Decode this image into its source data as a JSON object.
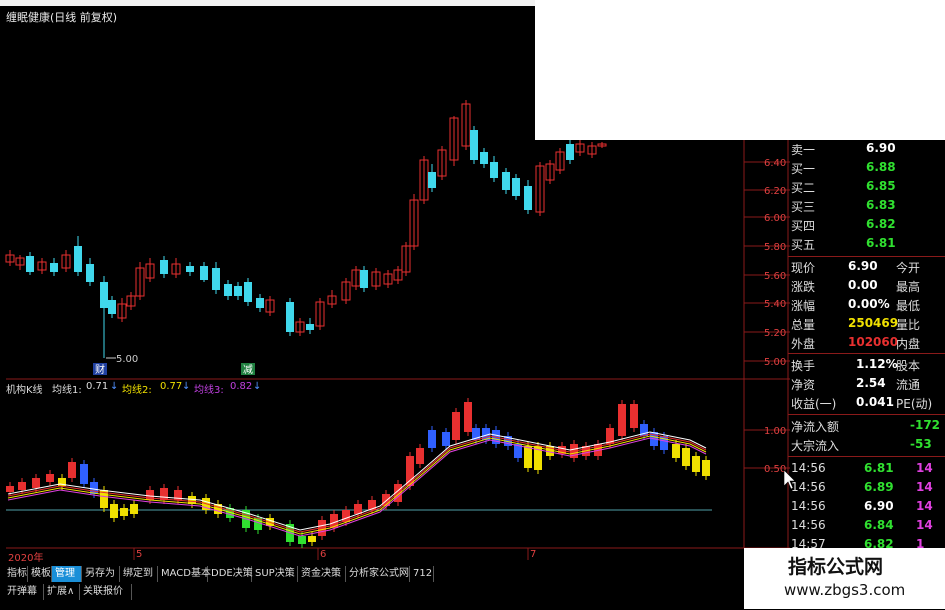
{
  "window": {
    "title": "缠眠健康(日线 前复权)"
  },
  "price_axis": [
    "6.40",
    "6.20",
    "6.00",
    "5.80",
    "5.60",
    "5.40",
    "5.20",
    "5.00"
  ],
  "low_marker": "5.00",
  "candle_labels": {
    "cai": "财",
    "jian": "减"
  },
  "indicator": {
    "name": "机构K线",
    "ma1_label": "均线1:",
    "ma1_value": "0.71",
    "ma2_label": "均线2:",
    "ma2_value": "0.77",
    "ma3_label": "均线3:",
    "ma3_value": "0.82",
    "axis": [
      "1.00",
      "0.50"
    ]
  },
  "timeline": {
    "year": "2020年",
    "m5": "5",
    "m6": "6",
    "m7": "7"
  },
  "quote": {
    "asks": [
      {
        "label": "卖一",
        "price": "6.90"
      },
      {
        "label": "买一",
        "price": "6.88"
      },
      {
        "label": "买二",
        "price": "6.85"
      },
      {
        "label": "买三",
        "price": "6.83"
      },
      {
        "label": "买四",
        "price": "6.82"
      },
      {
        "label": "买五",
        "price": "6.81"
      }
    ],
    "stats": [
      {
        "label": "现价",
        "value": "6.90",
        "tail": "今开"
      },
      {
        "label": "涨跌",
        "value": "0.00",
        "tail": "最高"
      },
      {
        "label": "涨幅",
        "value": "0.00%",
        "tail": "最低"
      },
      {
        "label": "总量",
        "value": "250469",
        "tail": "量比"
      },
      {
        "label": "外盘",
        "value": "102060",
        "tail": "内盘"
      }
    ],
    "stats2": [
      {
        "label": "换手",
        "value": "1.12%",
        "tail": "股本"
      },
      {
        "label": "净资",
        "value": "2.54",
        "tail": "流通"
      },
      {
        "label": "收益(一)",
        "value": "0.041",
        "tail": "PE(动)"
      }
    ],
    "flow": [
      {
        "label": "净流入额",
        "value": "-172"
      },
      {
        "label": "大宗流入",
        "value": "-53"
      }
    ],
    "ticks": [
      {
        "time": "14:56",
        "price": "6.81",
        "vol": "14"
      },
      {
        "time": "14:56",
        "price": "6.89",
        "vol": "14"
      },
      {
        "time": "14:56",
        "price": "6.90",
        "vol": "14"
      },
      {
        "time": "14:56",
        "price": "6.84",
        "vol": "14"
      },
      {
        "time": "14:57",
        "price": "6.82",
        "vol": "1"
      }
    ]
  },
  "tabs": [
    "指标",
    "模板",
    "管理",
    "另存为",
    "绑定到",
    "MACD基本",
    "DDE决策",
    "SUP决策",
    "资金决策",
    "分析家公式网",
    "712"
  ],
  "tabs2": [
    "开弹幕",
    "扩展∧",
    "关联报价"
  ],
  "watermark": {
    "line1": "指标公式网",
    "line2": "www.zbgs3.com"
  },
  "colors": {
    "up": "#e83030",
    "down": "#40d8ec",
    "grid": "#8a1a1a",
    "green": "#30e030",
    "yellow": "#f0e000",
    "magenta": "#e040e0"
  }
}
